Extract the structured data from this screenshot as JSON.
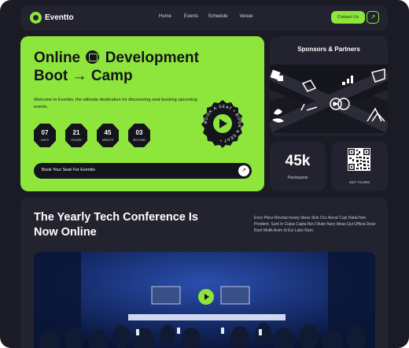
{
  "nav": {
    "brand": "Eventto",
    "links": [
      "Home",
      "Events",
      "Schedule",
      "Venue"
    ],
    "contact_label": "Contact Us",
    "contact_arrow": "↗"
  },
  "hero": {
    "title_line1_a": "Online",
    "title_line1_b": "Development",
    "title_line2": "Boot → Camp",
    "description": "Welcome to Eventto, the ultimate destination for discovering seat booking upcoming events.",
    "countdown": [
      {
        "value": "07",
        "label": "DAYS"
      },
      {
        "value": "21",
        "label": "HOURS"
      },
      {
        "value": "45",
        "label": "MINUTE"
      },
      {
        "value": "03",
        "label": "SECOND"
      }
    ],
    "seal_text": "BOOK A SEAT • BOOK A SEAT •",
    "seat_cta": "Book Your Seat For Eventto",
    "seat_arrow": "↗"
  },
  "sponsors": {
    "title": "Sponsors & Partners"
  },
  "stats": {
    "participants_value": "45k",
    "participants_label": "Participants",
    "qr_label": "GET YOURS"
  },
  "conference": {
    "title": "The Yearly Tech Conference Is Now Online",
    "description": "Exce Pteur Revolut lonary Ideas Sink Occ Aecat Cupi Datat Non Proident, Sunt In Culpa Capta Rev Olutio Nary Ideas Qui Officia Dese Runt Mollit Anim Id Est Labo Rum."
  },
  "colors": {
    "accent": "#8ee63c",
    "background": "#1b1b26",
    "card": "#23232f"
  }
}
